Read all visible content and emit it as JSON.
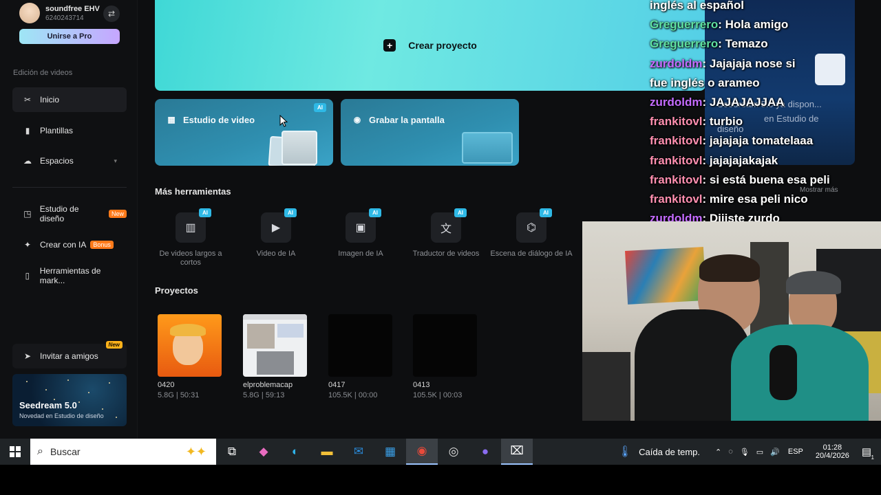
{
  "profile": {
    "name": "soundfree EHV",
    "id": "6240243714",
    "pro_label": "Unirse a Pro"
  },
  "sidebar": {
    "section_label": "Edición de videos",
    "items": [
      {
        "label": "Inicio",
        "icon": "scissors-icon"
      },
      {
        "label": "Plantillas",
        "icon": "template-icon"
      },
      {
        "label": "Espacios",
        "icon": "cloud-icon"
      },
      {
        "label": "Estudio de diseño",
        "icon": "design-icon",
        "badge": "New"
      },
      {
        "label": "Crear con IA",
        "icon": "sparkle-icon",
        "badge": "Bonus"
      },
      {
        "label": "Herramientas de mark...",
        "icon": "marketing-icon"
      }
    ],
    "invite_label": "Invitar a amigos",
    "invite_tag": "New",
    "promo": {
      "title": "Seedream 5.0",
      "subtitle": "Novedad en Estudio de diseño"
    }
  },
  "hero": {
    "label": "Crear proyecto"
  },
  "cards": [
    {
      "label": "Estudio de video",
      "badge": "AI"
    },
    {
      "label": "Grabar la pantalla"
    }
  ],
  "tools": {
    "heading": "Más herramientas",
    "items": [
      {
        "label": "De videos largos a cortos",
        "badge": "AI",
        "icon": "film-icon"
      },
      {
        "label": "Video de IA",
        "badge": "AI",
        "icon": "video-ai-icon"
      },
      {
        "label": "Imagen de IA",
        "badge": "AI",
        "icon": "image-ai-icon"
      },
      {
        "label": "Traductor de videos",
        "badge": "AI",
        "icon": "translate-icon"
      },
      {
        "label": "Escena de diálogo de IA",
        "badge": "AI",
        "icon": "dialog-icon"
      }
    ]
  },
  "projects": {
    "heading": "Proyectos",
    "items": [
      {
        "name": "0420",
        "meta": "5.8G | 50:31"
      },
      {
        "name": "elproblemacap",
        "meta": "5.8G | 59:13"
      },
      {
        "name": "0417",
        "meta": "105.5K | 00:00"
      },
      {
        "name": "0413",
        "meta": "105.5K | 00:03"
      }
    ]
  },
  "chat": {
    "lines": [
      {
        "user": "",
        "text": "inglés al español",
        "color": "#ffffff"
      },
      {
        "user": "Greguerrero",
        "text": "Hola amigo",
        "color": "#5fe0a0"
      },
      {
        "user": "Greguerrero",
        "text": "Temazo",
        "color": "#5fe0a0"
      },
      {
        "user": "zurdoldm",
        "text": "Jajajaja nose si",
        "color": "#c46bff"
      },
      {
        "user": "",
        "text": "fue inglés o arameo",
        "color": "#ffffff"
      },
      {
        "user": "zurdoldm",
        "text": "JAJAJAJJAA",
        "color": "#c46bff"
      },
      {
        "user": "frankitovl",
        "text": "turbio",
        "color": "#ff8fb0"
      },
      {
        "user": "frankitovl",
        "text": "jajajaja tomatelaaa",
        "color": "#ff8fb0"
      },
      {
        "user": "frankitovl",
        "text": "jajajajakajak",
        "color": "#ff8fb0"
      },
      {
        "user": "frankitovl",
        "text": "si está buena esa peli",
        "color": "#ff8fb0"
      },
      {
        "user": "frankitovl",
        "text": "mire esa peli nico",
        "color": "#ff8fb0"
      },
      {
        "user": "zurdoldm",
        "text": "Dijiste zurdo",
        "color": "#c46bff"
      }
    ],
    "bg_text_1": "Seedream 5.0 ya dispon...",
    "bg_text_2": "en Estudio de",
    "bg_text_3": "diseño",
    "mostrar": "Mostrar más"
  },
  "taskbar": {
    "search_placeholder": "Buscar",
    "weather": "Caída de temp.",
    "lang": "ESP",
    "time": "01:28",
    "date": "20/4/2026",
    "notif_count": "1"
  }
}
